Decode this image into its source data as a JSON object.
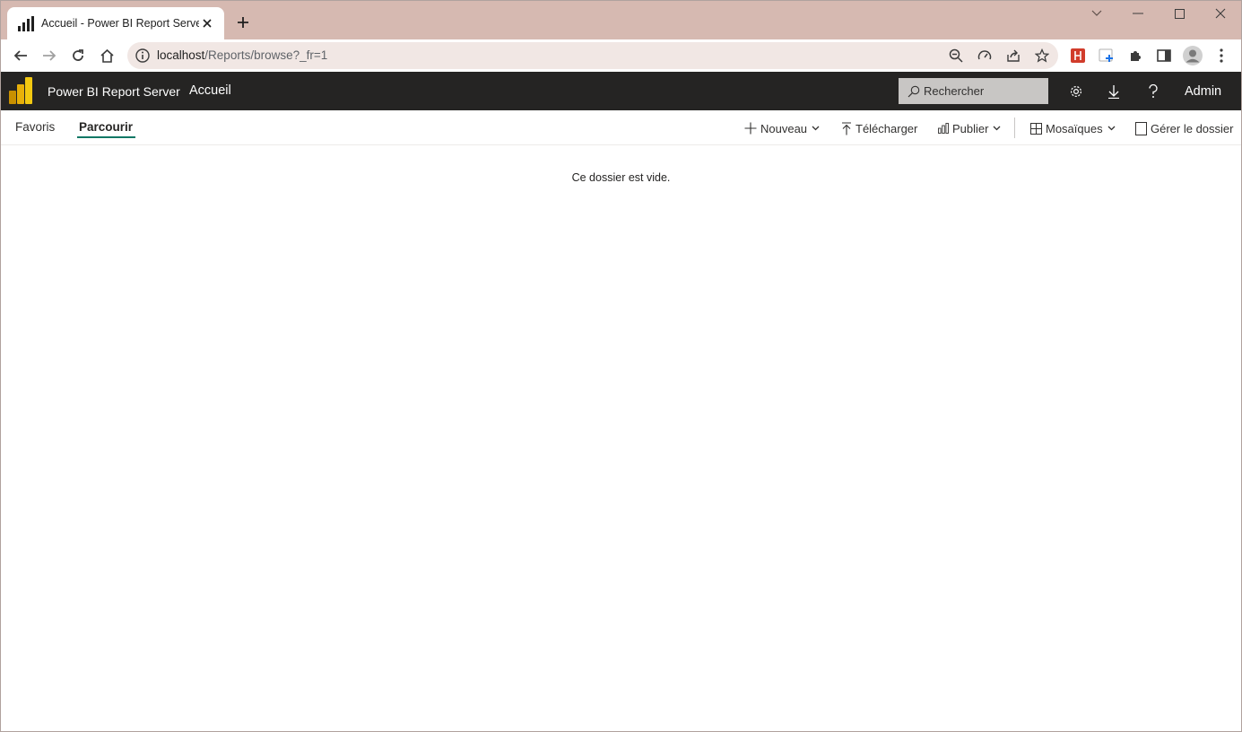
{
  "browser": {
    "tab_title": "Accueil - Power BI Report Server",
    "url_host": "localhost",
    "url_path": "/Reports/browse?_fr=1"
  },
  "header": {
    "app_name": "Power BI Report Server",
    "breadcrumb": "Accueil",
    "search_placeholder": "Rechercher",
    "user": "Admin"
  },
  "nav": {
    "tabs": [
      {
        "label": "Favoris",
        "active": false
      },
      {
        "label": "Parcourir",
        "active": true
      }
    ]
  },
  "commands": {
    "new": "Nouveau",
    "upload": "Télécharger",
    "publish": "Publier",
    "view": "Mosaïques",
    "manage": "Gérer le dossier"
  },
  "content": {
    "empty_message": "Ce dossier est vide."
  },
  "colors": {
    "tab_strip": "#d6b9b1",
    "header_bg": "#252423",
    "active_underline": "#117865",
    "logo_yellow": "#f2c811"
  }
}
